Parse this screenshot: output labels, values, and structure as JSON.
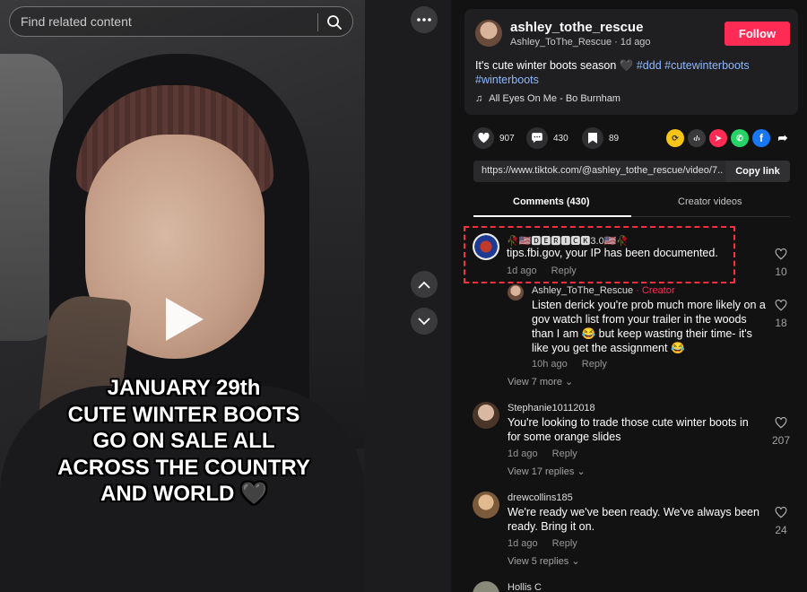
{
  "search": {
    "placeholder": "Find related content"
  },
  "video": {
    "overlay_lines": [
      "JANUARY 29th",
      "CUTE WINTER BOOTS",
      "GO ON SALE ALL",
      "ACROSS THE COUNTRY",
      "AND WORLD 🖤"
    ]
  },
  "post": {
    "username": "ashley_tothe_rescue",
    "display_meta": "Ashley_ToThe_Rescue · 1d ago",
    "follow_label": "Follow",
    "desc_text": "It's cute winter boots season 🖤 ",
    "hashtags": [
      "#ddd",
      "#cutewinterboots",
      "#winterboots"
    ],
    "music": "All Eyes On Me - Bo Burnham"
  },
  "stats": {
    "likes": "907",
    "comments": "430",
    "saves": "89"
  },
  "share": {
    "link": "https://www.tiktok.com/@ashley_tothe_rescue/video/7...",
    "copy_label": "Copy link"
  },
  "tabs": {
    "comments": "Comments (430)",
    "creator_videos": "Creator videos"
  },
  "comments": [
    {
      "user": "🥀🇺🇸🅳🅴🆁🅸🅲🅺3.0🇺🇸🥀",
      "text": "tips.fbi.gov, your IP has been documented.",
      "time": "1d ago",
      "reply": "Reply",
      "likes": "10"
    },
    {
      "user": "Ashley_ToThe_Rescue",
      "creator_tag": " · Creator",
      "text": "Listen derick you're prob much more likely on a gov watch list from your trailer in the woods than I am 😂 but keep wasting their time- it's like you get the assignment 😂",
      "time": "10h ago",
      "reply": "Reply",
      "likes": "18"
    },
    {
      "user": "Stephanie10112018",
      "text": "You're looking to trade those cute winter boots in for some orange slides",
      "time": "1d ago",
      "reply": "Reply",
      "likes": "207"
    },
    {
      "user": "drewcollins185",
      "text": "We're ready we've been ready. We've always been ready. Bring it on.",
      "time": "1d ago",
      "reply": "Reply",
      "likes": "24"
    },
    {
      "user": "Hollis C"
    }
  ],
  "view_more": {
    "first": "View 7 more",
    "second": "View 17 replies",
    "third": "View 5 replies"
  },
  "colors": {
    "accent": "#fe2c55",
    "hashtag": "#8fb8ff",
    "highlight": "#ff2e3a"
  }
}
